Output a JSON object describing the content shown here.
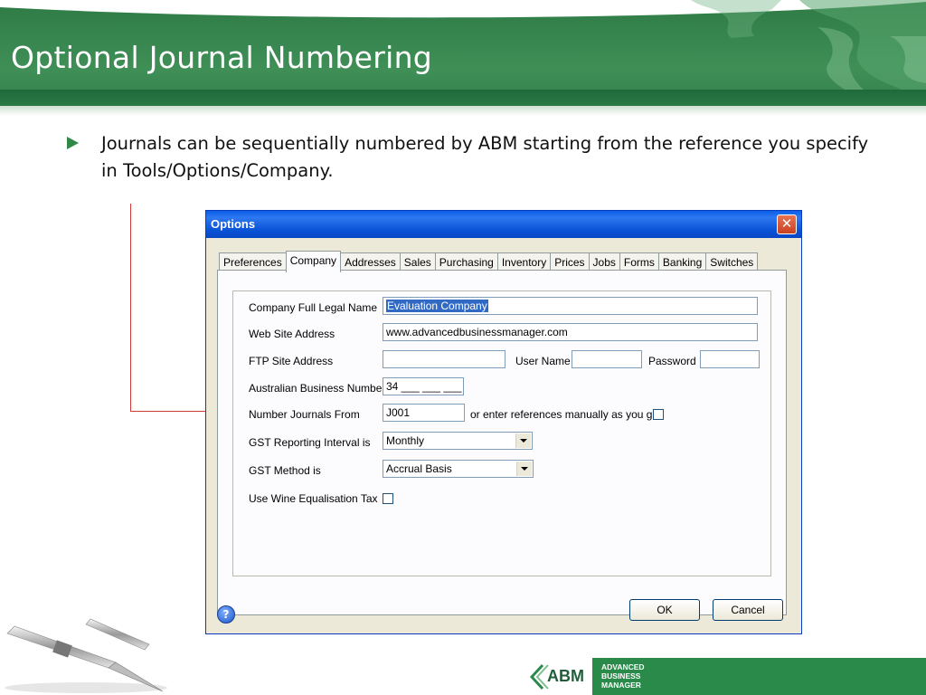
{
  "slide": {
    "title": "Optional Journal Numbering",
    "bullet": "Journals can be sequentially numbered by ABM starting from the reference you specify in Tools/Options/Company."
  },
  "dialog": {
    "title": "Options",
    "close_glyph": "✕",
    "tabs": [
      {
        "label": "Preferences"
      },
      {
        "label": "Company"
      },
      {
        "label": "Addresses"
      },
      {
        "label": "Sales"
      },
      {
        "label": "Purchasing"
      },
      {
        "label": "Inventory"
      },
      {
        "label": "Prices"
      },
      {
        "label": "Jobs"
      },
      {
        "label": "Forms"
      },
      {
        "label": "Banking"
      },
      {
        "label": "Switches"
      }
    ],
    "active_tab": "Company",
    "fields": {
      "legal_name_label": "Company Full Legal Name",
      "legal_name_value": "Evaluation Company",
      "website_label": "Web Site Address",
      "website_value": "www.advancedbusinessmanager.com",
      "ftp_label": "FTP Site Address",
      "ftp_value": "",
      "username_label": "User Name",
      "username_value": "",
      "password_label": "Password",
      "password_value": "",
      "abn_label": "Australian Business Number",
      "abn_value": "34 ___ ___ ___",
      "journals_label": "Number Journals From",
      "journals_value": "J001",
      "manual_label": "or enter references manually as you go",
      "manual_checked": false,
      "gst_interval_label": "GST Reporting Interval is",
      "gst_interval_value": "Monthly",
      "gst_method_label": "GST Method is",
      "gst_method_value": "Accrual Basis",
      "wine_label": "Use Wine Equalisation Tax",
      "wine_checked": false
    },
    "help_glyph": "?",
    "ok_label": "OK",
    "cancel_label": "Cancel"
  },
  "logo": {
    "mark": "ABM",
    "line1": "ADVANCED",
    "line2": "BUSINESS",
    "line3": "MANAGER"
  },
  "colors": {
    "header_green": "#3f8f57",
    "bullet_green": "#2f8a4a",
    "callout_red": "#d23a3a",
    "titlebar_blue": "#0a5ee8",
    "dialog_face": "#ece9d8"
  }
}
